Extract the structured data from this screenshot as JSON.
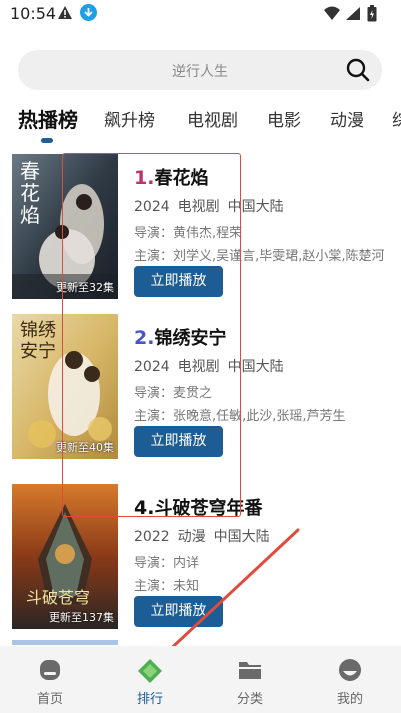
{
  "status_bar": {
    "time": "10:54"
  },
  "search": {
    "placeholder": "逆行人生"
  },
  "tabs": [
    "热播榜",
    "飙升榜",
    "电视剧",
    "电影",
    "动漫",
    "综"
  ],
  "list": [
    {
      "rank": "1.",
      "rank_color": "#c0306b",
      "title": "春花焰",
      "year": "2024",
      "genre": "电视剧",
      "region": "中国大陆",
      "director": "导演：黄伟杰,程荣",
      "cast": "主演：刘学义,吴谨言,毕雯珺,赵小棠,陈楚河",
      "poster_caption": "更新至32集",
      "poster_text": "春花焰",
      "play_label": "立即播放"
    },
    {
      "rank": "2.",
      "rank_color": "#4a55c8",
      "title": "锦绣安宁",
      "year": "2024",
      "genre": "电视剧",
      "region": "中国大陆",
      "director": "导演：麦贯之",
      "cast": "主演：张晚意,任敏,此沙,张瑶,芦芳生",
      "poster_caption": "更新至40集",
      "poster_text": "锦绣安宁",
      "play_label": "立即播放"
    },
    {
      "rank": "4.",
      "rank_color": "#111111",
      "title": "斗破苍穹年番",
      "year": "2022",
      "genre": "动漫",
      "region": "中国大陆",
      "director": "导演：内详",
      "cast": "主演：未知",
      "poster_caption": "更新至137集",
      "poster_text": "斗破苍穹",
      "play_label": "立即播放"
    }
  ],
  "bottom_nav": [
    {
      "label": "首页",
      "icon": "home-icon"
    },
    {
      "label": "排行",
      "icon": "ranking-icon"
    },
    {
      "label": "分类",
      "icon": "folder-icon"
    },
    {
      "label": "我的",
      "icon": "profile-icon"
    }
  ],
  "colors": {
    "accent": "#1c5d96",
    "annotation": "#e24b3b"
  }
}
